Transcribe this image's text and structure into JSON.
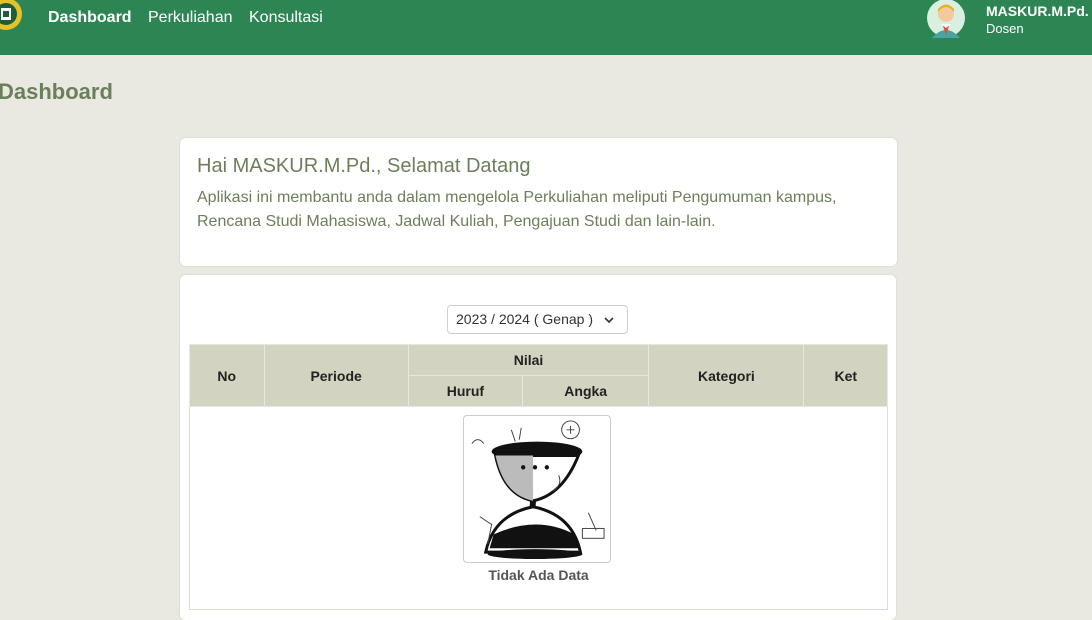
{
  "nav": {
    "links": [
      "Dashboard",
      "Perkuliahan",
      "Konsultasi"
    ],
    "user_name": "MASKUR.M.Pd.",
    "user_role": "Dosen"
  },
  "page": {
    "title": "Dashboard"
  },
  "welcome": {
    "heading": "Hai MASKUR.M.Pd., Selamat Datang",
    "text": "Aplikasi ini membantu anda dalam mengelola Perkuliahan meliputi Pengumuman kampus, Rencana Studi Mahasiswa, Jadwal Kuliah, Pengajuan Studi dan lain-lain."
  },
  "period": {
    "selected": "2023 / 2024 ( Genap )"
  },
  "table": {
    "headers": {
      "no": "No",
      "periode": "Periode",
      "nilai": "Nilai",
      "huruf": "Huruf",
      "angka": "Angka",
      "kategori": "Kategori",
      "ket": "Ket"
    },
    "empty_text": "Tidak Ada Data"
  },
  "colors": {
    "navbar": "#2e8554",
    "page_bg": "#e9e9e2",
    "table_header": "#d2d3c0",
    "heading_text": "#6b7f5a"
  },
  "icons": [
    "university-logo-icon",
    "user-avatar-icon",
    "chevron-down-icon",
    "empty-hourglass-illustration"
  ]
}
